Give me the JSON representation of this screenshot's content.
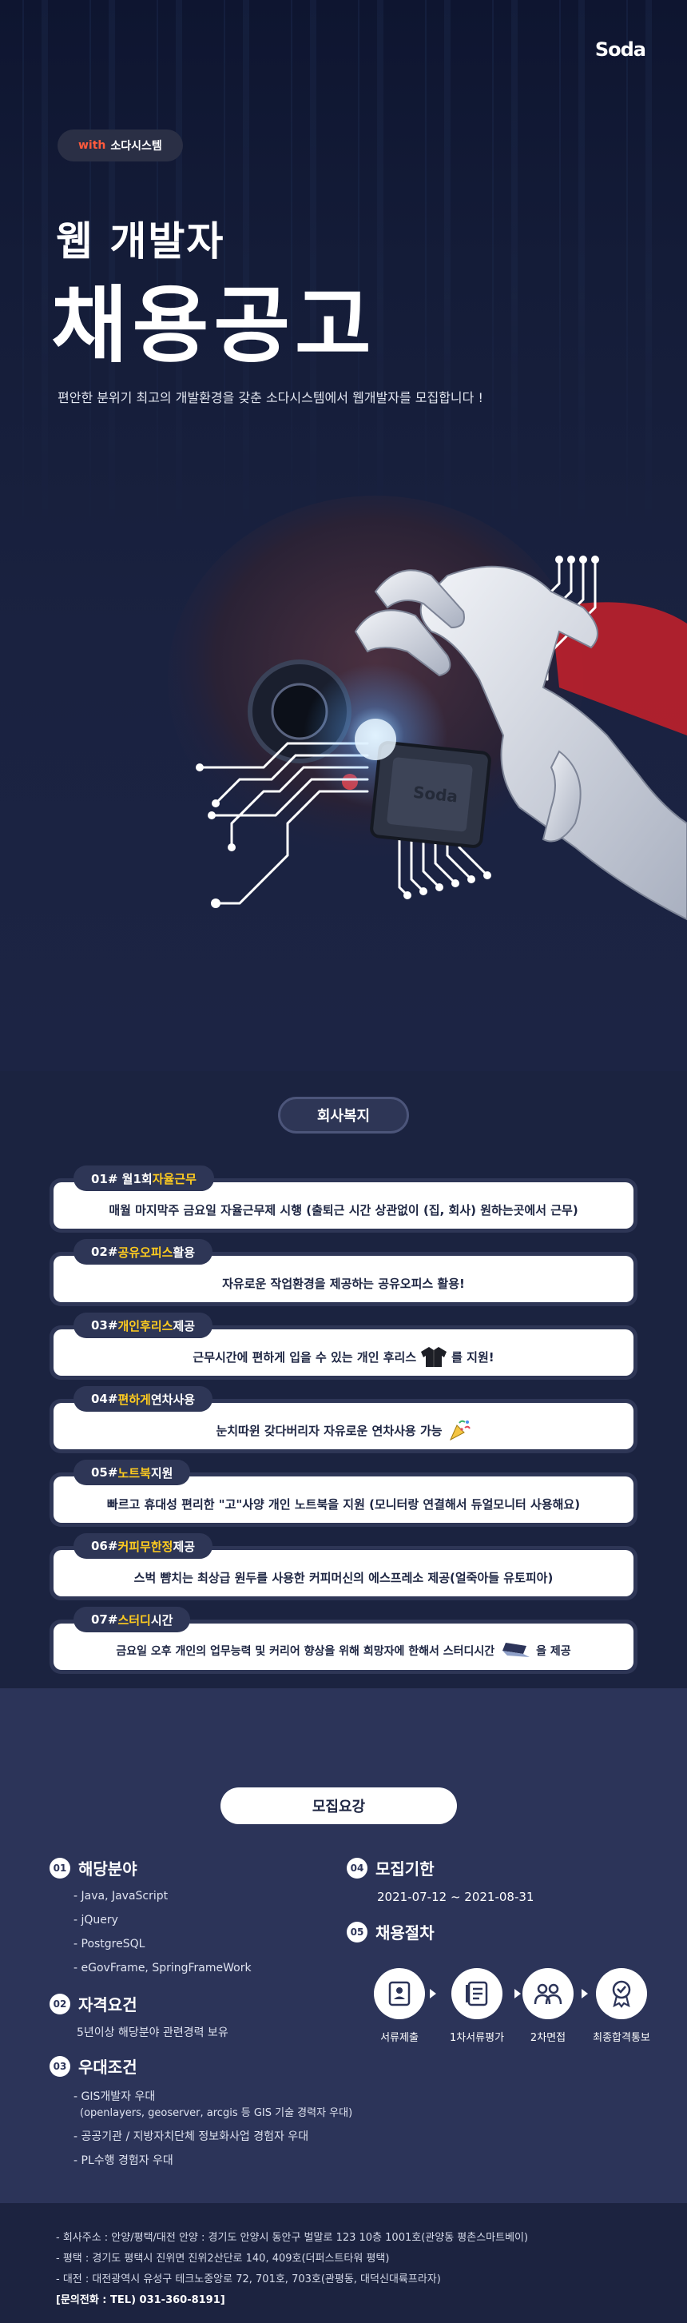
{
  "hero": {
    "logo": "Soda",
    "with_prefix": "with",
    "with_company": "소다시스템",
    "subtitle": "웹 개발자",
    "title": "채용공고",
    "description": "편안한 분위기 최고의 개발환경을 갖춘 소다시스템에서 웹개발자를 모집합니다 !",
    "chip_text": "Soda"
  },
  "benefits": {
    "section_title": "회사복지",
    "items": [
      {
        "tag_prefix": "01# 월1회 ",
        "tag_highlight": "자율근무",
        "tag_suffix": "",
        "text": "매월 마지막주 금요일 자율근무제 시행 (출퇴근 시간 상관없이 (집, 회사) 원하는곳에서 근무)"
      },
      {
        "tag_prefix": "02# ",
        "tag_highlight": "공유오피스",
        "tag_suffix": " 활용",
        "text": "자유로운 작업환경을 제공하는 공유오피스 활용!"
      },
      {
        "tag_prefix": "03# ",
        "tag_highlight": "개인후리스",
        "tag_suffix": " 제공",
        "text_before": "근무시간에 편하게 입을 수 있는 개인 후리스",
        "text_after": "를 지원!"
      },
      {
        "tag_prefix": "04# ",
        "tag_highlight": "편하게",
        "tag_suffix": " 연차사용",
        "text": "눈치따윈 갖다버리자 자유로운 연차사용 가능"
      },
      {
        "tag_prefix": "05# ",
        "tag_highlight": "노트북",
        "tag_suffix": " 지원",
        "text": "빠르고 휴대성 편리한 \"고\"사양 개인 노트북을 지원 (모니터랑 연결해서 듀얼모니터 사용해요)"
      },
      {
        "tag_prefix": "06# ",
        "tag_highlight": "커피무한정",
        "tag_suffix": " 제공",
        "text": "스벅 뺨치는 최상급 원두를 사용한 커피머신의 에스프레소 제공(얼죽아들 유토피아)"
      },
      {
        "tag_prefix": "07# ",
        "tag_highlight": "스터디",
        "tag_suffix": " 시간",
        "text_before": "금요일 오후 개인의 업무능력 및 커리어 향상을 위해 희망자에 한해서 스터디시간",
        "text_after": "을 제공"
      }
    ]
  },
  "recruit": {
    "section_title": "모집요강",
    "field": {
      "num": "01",
      "title": "해당분야",
      "lines": [
        "- Java, JavaScript",
        "- jQuery",
        "- PostgreSQL",
        "- eGovFrame, SpringFrameWork"
      ]
    },
    "qualification": {
      "num": "02",
      "title": "자격요건",
      "lines": [
        "5년이상 해당분야 관련경력 보유"
      ]
    },
    "preferred": {
      "num": "03",
      "title": "우대조건",
      "lines": [
        "- GIS개발자 우대",
        "(openlayers, geoserver, arcgis 등 GIS 기술 경력자 우대)",
        "- 공공기관 / 지방자치단체 정보화사업 경험자 우대",
        "- PL수행 경험자 우대"
      ]
    },
    "period": {
      "num": "04",
      "title": "모집기한",
      "value": "2021-07-12 ~ 2021-08-31"
    },
    "process": {
      "num": "05",
      "title": "채용절차",
      "steps": [
        "서류제출",
        "1차서류평가",
        "2차면접",
        "최종합격통보"
      ]
    }
  },
  "footer": {
    "lines": [
      "- 회사주소 : 안양/평택/대전 안양 : 경기도 안양시 동안구 벌말로 123 10층 1001호(관양동 평촌스마트베이)",
      "- 평택 : 경기도 평택시 진위면 진위2산단로 140, 409호(더퍼스트타워 평택)",
      "- 대전 : 대전광역시 유성구 테크노중앙로 72, 701호, 703호(관평동, 대덕신대륙프라자)",
      "[문의전화 : TEL) 031-360-8191]"
    ]
  }
}
